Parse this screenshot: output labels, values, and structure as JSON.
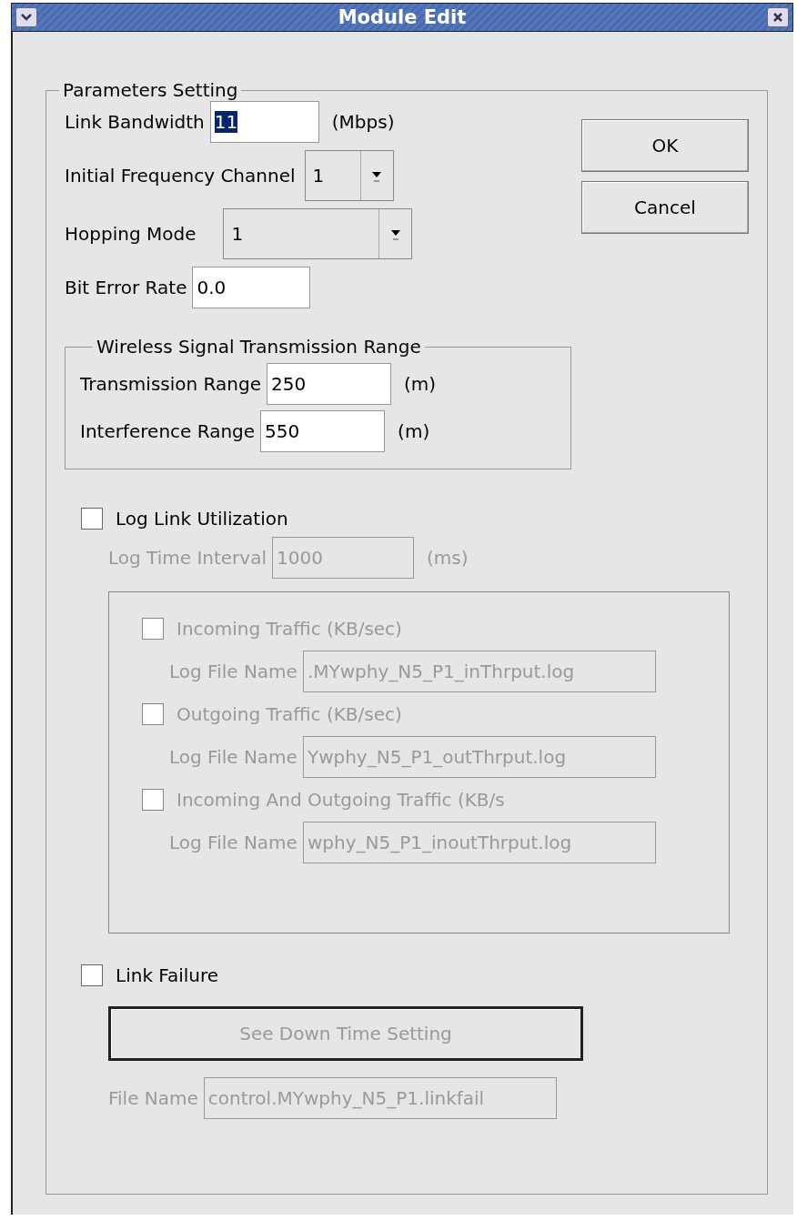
{
  "window": {
    "title": "Module Edit"
  },
  "buttons": [
    {
      "label": "OK"
    },
    {
      "label": "Cancel"
    }
  ],
  "parameters": {
    "title": "Parameters Setting",
    "rows": [
      {
        "kind": "text",
        "label": "Link Bandwidth",
        "value": "11",
        "selected": true,
        "unit": "(Mbps)"
      },
      {
        "kind": "combo",
        "label": "Initial Frequency Channel",
        "value": "1"
      },
      {
        "kind": "combo",
        "label": "Hopping Mode",
        "value": "1"
      },
      {
        "kind": "text",
        "label": "Bit Error Rate",
        "value": "0.0",
        "selected": false
      }
    ]
  },
  "range_group": {
    "title": "Wireless Signal Transmission Range",
    "fields": [
      {
        "label": "Transmission Range",
        "value": "250",
        "unit": "(m)"
      },
      {
        "label": "Interference Range",
        "value": "550",
        "unit": "(m)"
      }
    ]
  },
  "log_link_utilization": {
    "label": "Log Link Utilization",
    "checked": false,
    "interval": {
      "label": "Log Time Interval",
      "value": "1000",
      "unit": "(ms)",
      "disabled": true
    },
    "traffic": [
      {
        "label": "Incoming Traffic (KB/sec)",
        "checked": false,
        "disabled": true,
        "file_label": "Log File Name",
        "file_value": ".MYwphy_N5_P1_inThrput.log"
      },
      {
        "label": "Outgoing Traffic (KB/sec)",
        "checked": false,
        "disabled": true,
        "file_label": "Log File Name",
        "file_value": "Ywphy_N5_P1_outThrput.log"
      },
      {
        "label": "Incoming And Outgoing Traffic (KB/s",
        "checked": false,
        "disabled": true,
        "file_label": "Log File Name",
        "file_value": "wphy_N5_P1_inoutThrput.log"
      }
    ]
  },
  "link_failure": {
    "label": "Link Failure",
    "checked": false,
    "button": {
      "label": "See Down Time Setting",
      "disabled": true
    },
    "file": {
      "label": "File Name",
      "value": "control.MYwphy_N5_P1.linkfail",
      "disabled": true
    }
  }
}
